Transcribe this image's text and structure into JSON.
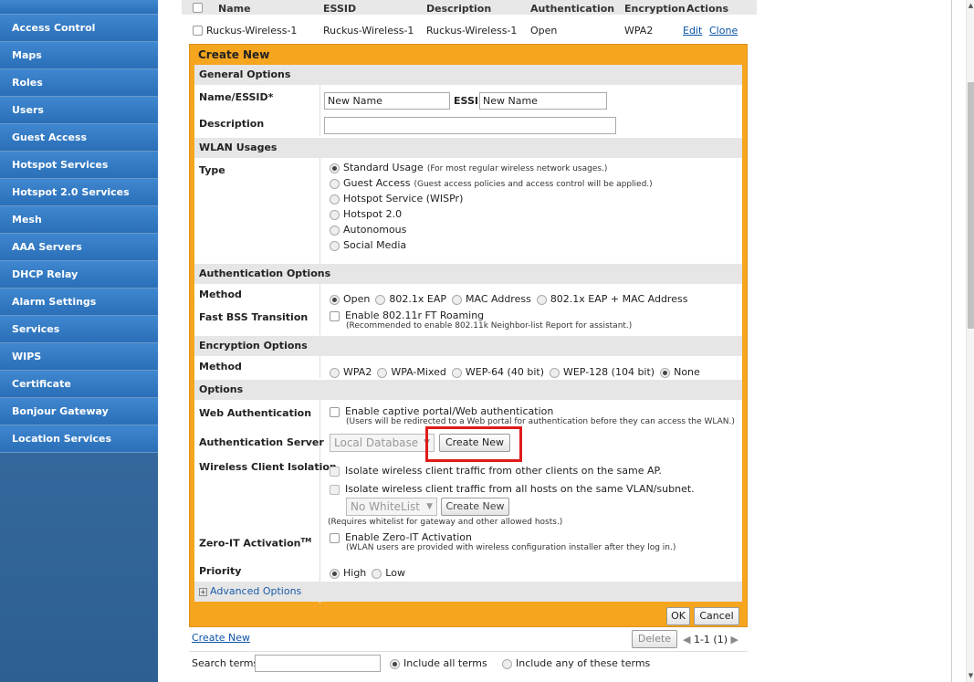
{
  "sidebar": {
    "items": [
      {
        "label": "Access Control"
      },
      {
        "label": "Maps"
      },
      {
        "label": "Roles"
      },
      {
        "label": "Users"
      },
      {
        "label": "Guest Access"
      },
      {
        "label": "Hotspot Services"
      },
      {
        "label": "Hotspot 2.0 Services"
      },
      {
        "label": "Mesh"
      },
      {
        "label": "AAA Servers"
      },
      {
        "label": "DHCP Relay"
      },
      {
        "label": "Alarm Settings"
      },
      {
        "label": "Services"
      },
      {
        "label": "WIPS"
      },
      {
        "label": "Certificate"
      },
      {
        "label": "Bonjour Gateway"
      },
      {
        "label": "Location Services"
      }
    ]
  },
  "wlan_table": {
    "headers": [
      "Name",
      "ESSID",
      "Description",
      "Authentication",
      "Encryption",
      "Actions"
    ],
    "rows": [
      {
        "name": "Ruckus-Wireless-1",
        "essid": "Ruckus-Wireless-1",
        "description": "Ruckus-Wireless-1",
        "authentication": "Open",
        "encryption": "WPA2",
        "edit": "Edit",
        "clone": "Clone"
      }
    ]
  },
  "create_panel": {
    "title": "Create New",
    "general": {
      "section": "General Options",
      "name_label": "Name/ESSID*",
      "name_value": "New Name",
      "essid_label": "ESSID",
      "essid_value": "New Name",
      "description_label": "Description",
      "description_value": ""
    },
    "usages": {
      "section": "WLAN Usages",
      "type_label": "Type",
      "options": [
        {
          "label": "Standard Usage",
          "note": "(For most regular wireless network usages.)",
          "selected": true
        },
        {
          "label": "Guest Access",
          "note": "(Guest access policies and access control will be applied.)",
          "selected": false
        },
        {
          "label": "Hotspot Service (WISPr)",
          "note": "",
          "selected": false
        },
        {
          "label": "Hotspot 2.0",
          "note": "",
          "selected": false
        },
        {
          "label": "Autonomous",
          "note": "",
          "selected": false
        },
        {
          "label": "Social Media",
          "note": "",
          "selected": false
        }
      ]
    },
    "auth": {
      "section": "Authentication Options",
      "method_label": "Method",
      "methods": [
        {
          "label": "Open",
          "selected": true
        },
        {
          "label": "802.1x EAP",
          "selected": false
        },
        {
          "label": "MAC Address",
          "selected": false
        },
        {
          "label": "802.1x EAP + MAC Address",
          "selected": false
        }
      ],
      "fbt_label": "Fast BSS Transition",
      "fbt_option": "Enable 802.11r FT Roaming",
      "fbt_note": "(Recommended to enable 802.11k Neighbor-list Report for assistant.)"
    },
    "encryption": {
      "section": "Encryption Options",
      "method_label": "Method",
      "methods": [
        {
          "label": "WPA2",
          "selected": false
        },
        {
          "label": "WPA-Mixed",
          "selected": false
        },
        {
          "label": "WEP-64 (40 bit)",
          "selected": false
        },
        {
          "label": "WEP-128 (104 bit)",
          "selected": false
        },
        {
          "label": "None",
          "selected": true
        }
      ]
    },
    "options": {
      "section": "Options",
      "webauth_label": "Web Authentication",
      "webauth_option": "Enable captive portal/Web authentication",
      "webauth_note": "(Users will be redirected to a Web portal for authentication before they can access the WLAN.)",
      "authserver_label": "Authentication Server",
      "authserver_value": "Local Database",
      "authserver_create": "Create New",
      "isolation_label": "Wireless Client Isolation",
      "isolation_opt1": "Isolate wireless client traffic from other clients on the same AP.",
      "isolation_opt2": "Isolate wireless client traffic from all hosts on the same VLAN/subnet.",
      "whitelist_value": "No WhiteList",
      "whitelist_create": "Create New",
      "whitelist_note": "(Requires whitelist for gateway and other allowed hosts.)",
      "zeroit_label": "Zero-IT Activation",
      "zeroit_tm": "TM",
      "zeroit_option": "Enable Zero-IT Activation",
      "zeroit_note": "(WLAN users are provided with wireless configuration installer after they log in.)",
      "priority_label": "Priority",
      "priority": [
        {
          "label": "High",
          "selected": true
        },
        {
          "label": "Low",
          "selected": false
        }
      ],
      "advanced": "Advanced Options"
    },
    "ok": "OK",
    "cancel": "Cancel"
  },
  "footer": {
    "create_new": "Create New",
    "delete": "Delete",
    "paging": "1-1 (1)",
    "search_label": "Search terms",
    "search_value": "",
    "include_all": "Include all terms",
    "include_any": "Include any of these terms"
  }
}
